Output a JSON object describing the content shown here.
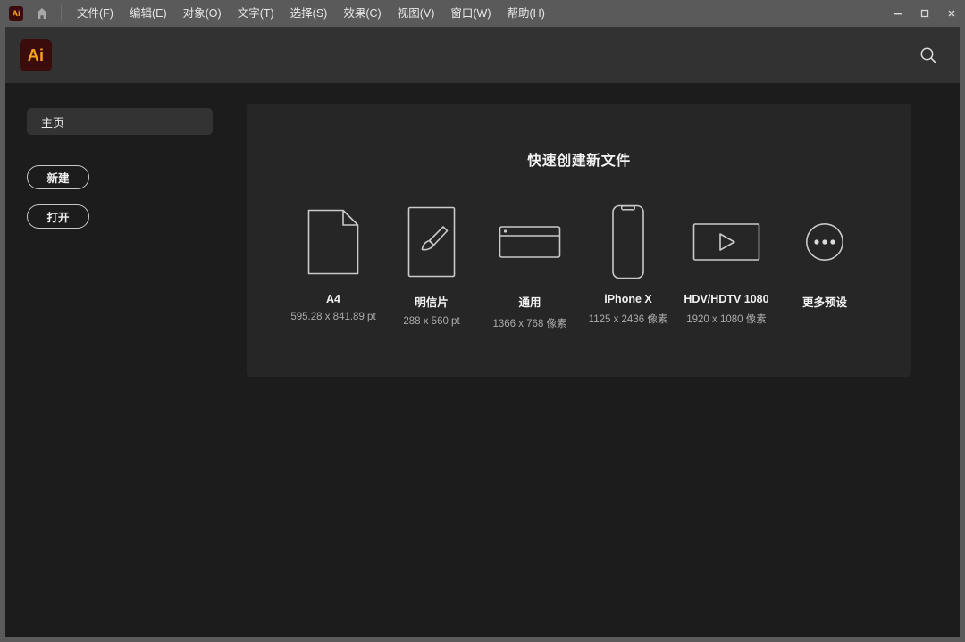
{
  "window": {
    "app_badge": "Ai",
    "home_icon": "home-icon",
    "minimize_label": "–",
    "maximize_label": "□",
    "close_label": "×"
  },
  "menubar": {
    "items": [
      {
        "label": "文件(F)"
      },
      {
        "label": "编辑(E)"
      },
      {
        "label": "对象(O)"
      },
      {
        "label": "文字(T)"
      },
      {
        "label": "选择(S)"
      },
      {
        "label": "效果(C)"
      },
      {
        "label": "视图(V)"
      },
      {
        "label": "窗口(W)"
      },
      {
        "label": "帮助(H)"
      }
    ]
  },
  "header": {
    "logo_text": "Ai",
    "search_icon": "search-icon"
  },
  "sidebar": {
    "tab": {
      "label": "主页"
    },
    "buttons": [
      {
        "label": "新建"
      },
      {
        "label": "打开"
      }
    ]
  },
  "card": {
    "title": "快速创建新文件",
    "presets": [
      {
        "name": "A4",
        "size": "595.28 x 841.89 pt",
        "icon": "document-page-icon"
      },
      {
        "name": "明信片",
        "size": "288 x 560 pt",
        "icon": "paintbrush-canvas-icon"
      },
      {
        "name": "通用",
        "size": "1366 x 768 像素",
        "icon": "browser-window-icon"
      },
      {
        "name": "iPhone X",
        "size": "1125 x 2436 像素",
        "icon": "phone-icon"
      },
      {
        "name": "HDV/HDTV 1080",
        "size": "1920 x 1080 像素",
        "icon": "video-play-icon"
      },
      {
        "name": "更多预设",
        "size": "",
        "icon": "more-ellipsis-icon"
      }
    ]
  },
  "colors": {
    "titlebar": "#5a5a5a",
    "header": "#323232",
    "app_background": "#1c1c1c",
    "card": "#262626",
    "accent_orange": "#f8a01c",
    "logo_maroon": "#3b0c0c",
    "text_primary": "#f0f0f0",
    "text_secondary": "#aaaaaa"
  }
}
